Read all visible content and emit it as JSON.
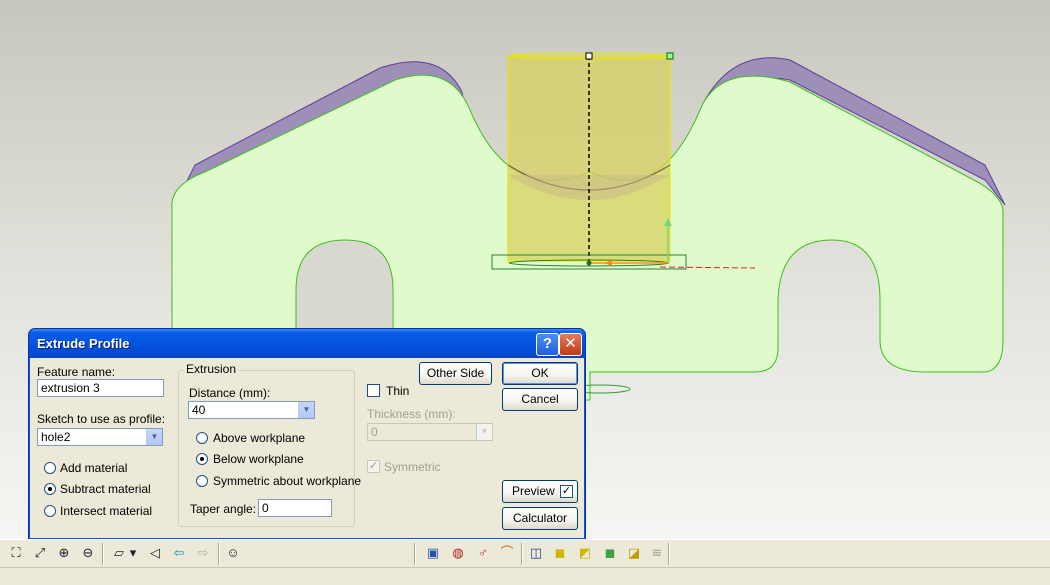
{
  "dialog": {
    "title": "Extrude Profile",
    "help_glyph": "?",
    "close_glyph": "✕",
    "feature_name_label": "Feature name:",
    "feature_name_value": "extrusion 3",
    "sketch_label": "Sketch to use as profile:",
    "sketch_value": "hole2",
    "material_options": [
      {
        "label": "Add material",
        "selected": false
      },
      {
        "label": "Subtract material",
        "selected": true
      },
      {
        "label": "Intersect material",
        "selected": false
      }
    ],
    "extrusion_group_title": "Extrusion",
    "distance_label": "Distance (mm):",
    "distance_value": "40",
    "plane_options": [
      {
        "label": "Above workplane",
        "selected": false
      },
      {
        "label": "Below workplane",
        "selected": true
      },
      {
        "label": "Symmetric about workplane",
        "selected": false
      }
    ],
    "taper_label": "Taper angle:",
    "taper_value": "0",
    "other_side_label": "Other Side",
    "thin_label": "Thin",
    "thin_checked": false,
    "thickness_label": "Thickness (mm):",
    "thickness_value": "0",
    "symmetric_label": "Symmetric",
    "symmetric_checked": true,
    "ok_label": "OK",
    "cancel_label": "Cancel",
    "preview_label": "Preview",
    "preview_checked": true,
    "calculator_label": "Calculator"
  },
  "colors": {
    "part_fill": "#e0fbcb",
    "part_edge": "#3fbf1f",
    "side_wall": "#9e8fb8",
    "cylinder_fill": "#d8d060",
    "cylinder_edge": "#f0f000",
    "titlebar": "#0555e0"
  },
  "toolbar": {
    "icons": [
      "zoom-fit-icon",
      "zoom-window-icon",
      "zoom-in-icon",
      "zoom-out-icon",
      "view-plane-icon",
      "dropdown-arrow-icon",
      "look-at-icon",
      "back-arrow-icon",
      "forward-arrow-icon",
      "smiley-icon",
      "extrude-icon",
      "revolve-icon",
      "sweep-icon",
      "pipe-icon",
      "hole-icon",
      "cube-yellow-icon",
      "shell-icon",
      "cube-green-icon",
      "cube-fillet-icon",
      "stack-icon"
    ],
    "glyphs": {
      "zoom-fit": "⛶",
      "zoom-window": "⤢",
      "zoom-in": "⊕",
      "zoom-out": "⊖",
      "plane": "⏥",
      "dropdown": "▾",
      "look": "◁",
      "back": "⇦",
      "forward": "⇨",
      "smiley": "☺",
      "extrude": "▣",
      "revolve": "◍",
      "sweep": "♂",
      "pipe": "⌒",
      "hole": "◫",
      "cube1": "◼",
      "shell": "◩",
      "cube2": "◼",
      "cube3": "◪",
      "stack": "≋"
    }
  }
}
